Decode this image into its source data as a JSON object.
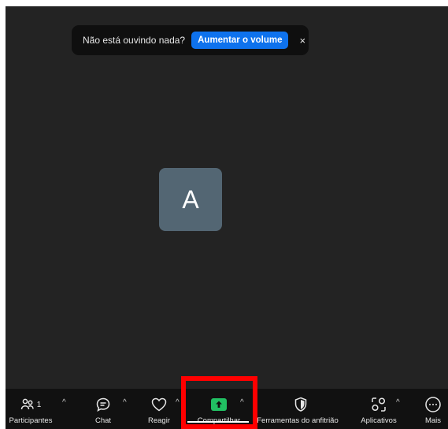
{
  "notice": {
    "text": "Não está ouvindo nada?",
    "action_label": "Aumentar o volume",
    "close_glyph": "×"
  },
  "avatar": {
    "initial": "A",
    "color": "#536673"
  },
  "toolbar": {
    "participants": {
      "label": "Participantes",
      "count": "1",
      "icon": "participants-icon"
    },
    "chat": {
      "label": "Chat",
      "icon": "chat-icon"
    },
    "react": {
      "label": "Reagir",
      "icon": "heart-icon"
    },
    "share": {
      "label": "Compartilhar",
      "icon": "share-screen-icon",
      "accent": "#21c063"
    },
    "host_tools": {
      "label": "Ferramentas do anfitrião",
      "icon": "shield-icon"
    },
    "apps": {
      "label": "Aplicativos",
      "icon": "apps-icon"
    },
    "more": {
      "label": "Mais",
      "icon": "more-icon"
    },
    "caret_glyph": "^"
  },
  "colors": {
    "background": "#232323",
    "toolbar": "#111111",
    "primary_button": "#0e72ed",
    "highlight": "#ff0000"
  }
}
